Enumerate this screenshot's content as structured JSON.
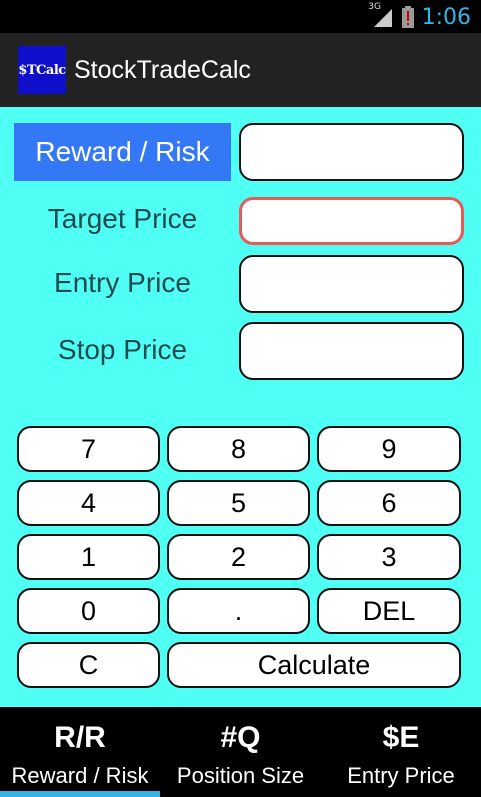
{
  "status_bar": {
    "network": "3G",
    "time": "1:06",
    "signal_icon": "signal-icon",
    "battery_icon": "battery-alert-icon",
    "accent_color": "#33b5e5"
  },
  "action_bar": {
    "logo_text": "$TCalc",
    "title": "StockTradeCalc"
  },
  "form": {
    "mode_label": "Reward / Risk",
    "target_label": "Target Price",
    "entry_label": "Entry Price",
    "stop_label": "Stop Price",
    "result_value": "",
    "target_value": "",
    "entry_value": "",
    "stop_value": ""
  },
  "keypad": {
    "k7": "7",
    "k8": "8",
    "k9": "9",
    "k4": "4",
    "k5": "5",
    "k6": "6",
    "k1": "1",
    "k2": "2",
    "k3": "3",
    "k0": "0",
    "kdot": ".",
    "kdel": "DEL",
    "kclear": "C",
    "kcalc": "Calculate"
  },
  "tabs": [
    {
      "abbr": "R/R",
      "label": "Reward / Risk",
      "selected": true
    },
    {
      "abbr": "#Q",
      "label": "Position Size",
      "selected": false
    },
    {
      "abbr": "$E",
      "label": "Entry Price",
      "selected": false
    }
  ],
  "colors": {
    "background": "#4ffff4",
    "mode_label_bg": "#3478f6",
    "focus_border": "#e85a5a",
    "label_text": "#234a50"
  }
}
